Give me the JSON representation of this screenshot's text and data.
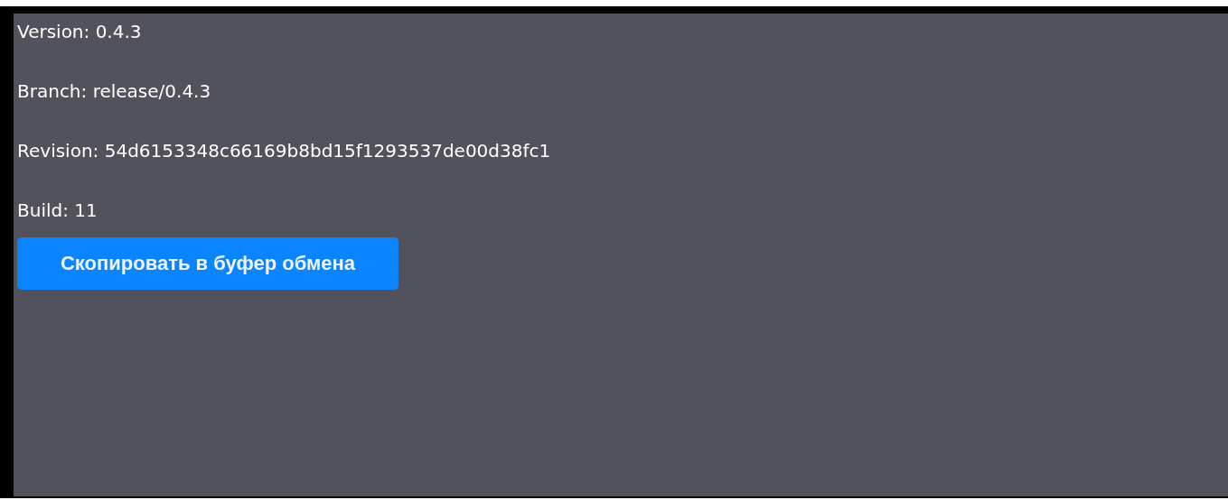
{
  "info_lines": [
    {
      "label": "Version: 0.4.3"
    },
    {
      "label": "Branch: release/0.4.3"
    },
    {
      "label": "Revision: 54d6153348c66169b8bd15f1293537de00d38fc1"
    },
    {
      "label": "Build: 11"
    }
  ],
  "copy_button": {
    "label": "Скопировать в буфер обмена"
  }
}
